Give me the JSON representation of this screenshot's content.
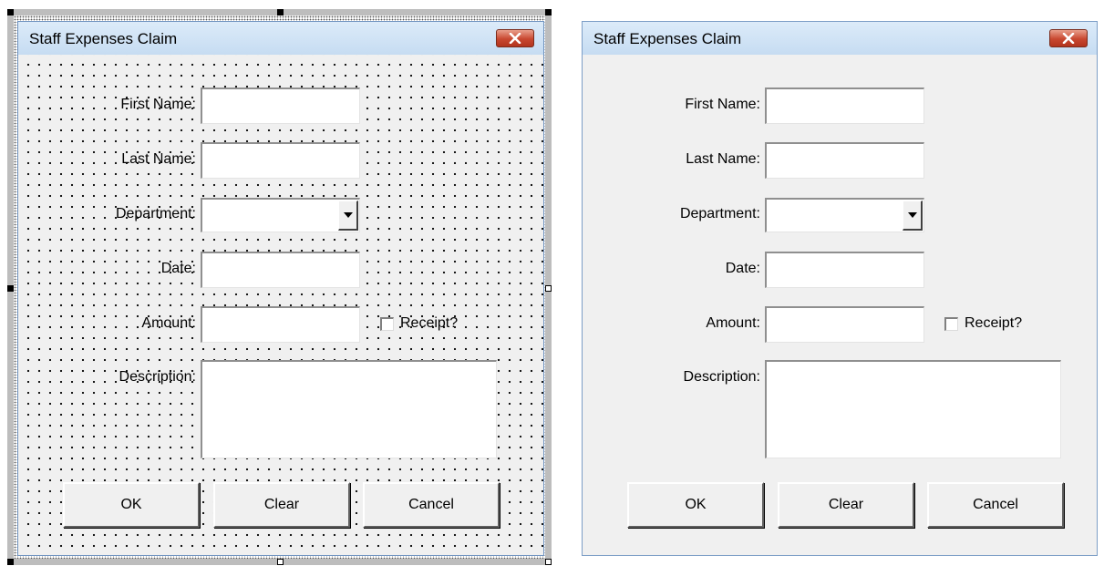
{
  "dialog": {
    "title": "Staff Expenses Claim",
    "labels": {
      "first_name": "First Name:",
      "last_name": "Last Name:",
      "department": "Department:",
      "date": "Date:",
      "amount": "Amount:",
      "description": "Description:"
    },
    "values": {
      "first_name": "",
      "last_name": "",
      "department": "",
      "date": "",
      "amount": "",
      "description": ""
    },
    "receipt_label": "Receipt?",
    "receipt_checked": false,
    "buttons": {
      "ok": "OK",
      "clear": "Clear",
      "cancel": "Cancel"
    }
  },
  "colors": {
    "titlebar": "#c6dcf2",
    "close_button": "#c8472f",
    "form_background": "#f0f0f0"
  },
  "icons": {
    "close": "close-icon",
    "dropdown": "chevron-down-icon"
  }
}
